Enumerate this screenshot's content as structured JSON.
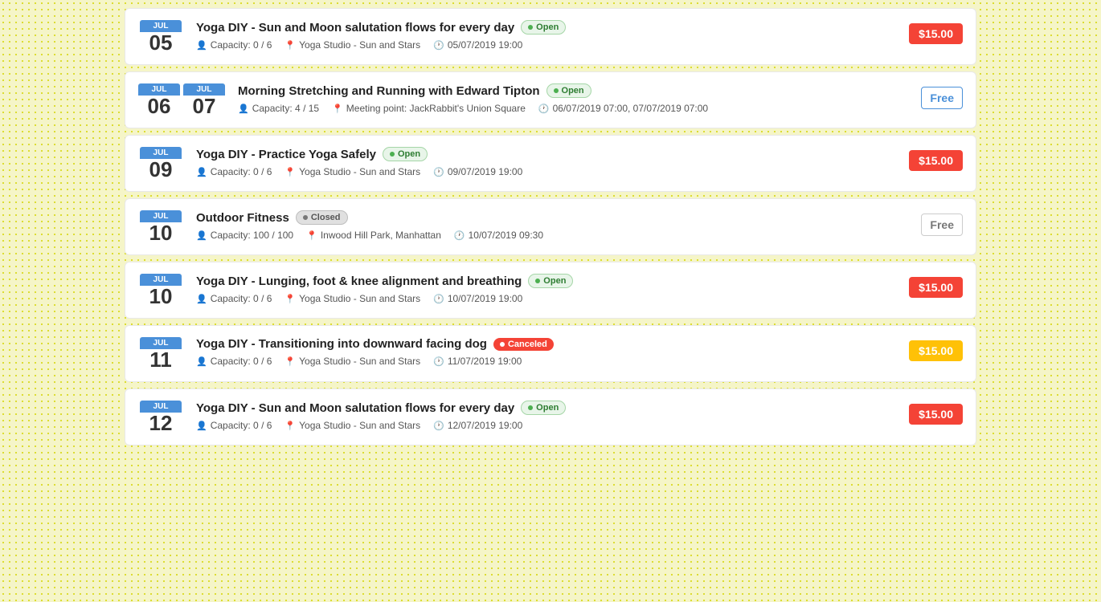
{
  "events": [
    {
      "id": "event-1",
      "month": "JUL",
      "day": "05",
      "title": "Yoga DIY - Sun and Moon salutation flows for every day",
      "status": "Open",
      "status_type": "open",
      "capacity": "Capacity: 0 / 6",
      "location": "Yoga Studio - Sun and Stars",
      "datetime": "05/07/2019 19:00",
      "price": "$15.00",
      "price_type": "red"
    },
    {
      "id": "event-2",
      "month1": "JUL",
      "month2": "JUL",
      "day1": "06",
      "day2": "07",
      "double_date": true,
      "title": "Morning Stretching and Running with Edward Tipton",
      "status": "Open",
      "status_type": "open",
      "capacity": "Capacity: 4 / 15",
      "location": "Meeting point: JackRabbit's Union Square",
      "datetime": "06/07/2019 07:00, 07/07/2019 07:00",
      "price": "Free",
      "price_type": "blue-free"
    },
    {
      "id": "event-3",
      "month": "JUL",
      "day": "09",
      "title": "Yoga DIY - Practice Yoga Safely",
      "status": "Open",
      "status_type": "open",
      "capacity": "Capacity: 0 / 6",
      "location": "Yoga Studio - Sun and Stars",
      "datetime": "09/07/2019 19:00",
      "price": "$15.00",
      "price_type": "red"
    },
    {
      "id": "event-4",
      "month": "JUL",
      "day": "10",
      "title": "Outdoor Fitness",
      "status": "Closed",
      "status_type": "closed",
      "capacity": "Capacity: 100 / 100",
      "location": "Inwood Hill Park, Manhattan",
      "datetime": "10/07/2019 09:30",
      "price": "Free",
      "price_type": "gray-free"
    },
    {
      "id": "event-5",
      "month": "JUL",
      "day": "10",
      "title": "Yoga DIY - Lunging, foot & knee alignment and breathing",
      "status": "Open",
      "status_type": "open",
      "capacity": "Capacity: 0 / 6",
      "location": "Yoga Studio - Sun and Stars",
      "datetime": "10/07/2019 19:00",
      "price": "$15.00",
      "price_type": "red"
    },
    {
      "id": "event-6",
      "month": "JUL",
      "day": "11",
      "title": "Yoga DIY - Transitioning into downward facing dog",
      "status": "Canceled",
      "status_type": "canceled",
      "capacity": "Capacity: 0 / 6",
      "location": "Yoga Studio - Sun and Stars",
      "datetime": "11/07/2019 19:00",
      "price": "$15.00",
      "price_type": "yellow"
    },
    {
      "id": "event-7",
      "month": "JUL",
      "day": "12",
      "title": "Yoga DIY - Sun and Moon salutation flows for every day",
      "status": "Open",
      "status_type": "open",
      "capacity": "Capacity: 0 / 6",
      "location": "Yoga Studio - Sun and Stars",
      "datetime": "12/07/2019 19:00",
      "price": "$15.00",
      "price_type": "red"
    }
  ]
}
